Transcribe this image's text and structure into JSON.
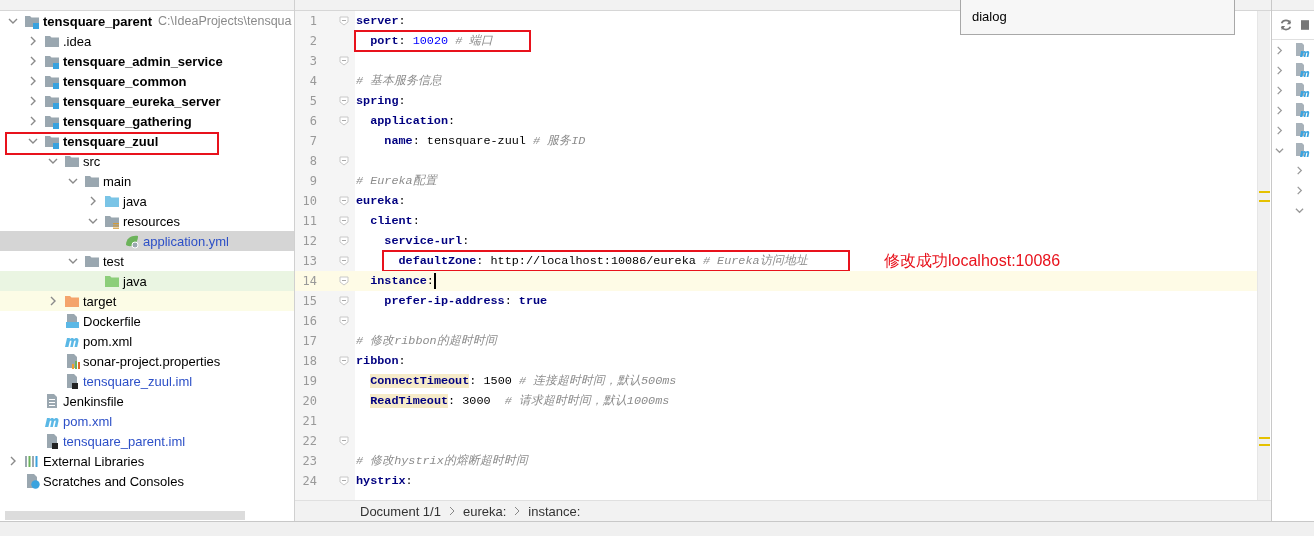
{
  "tooltip": {
    "text": "dialog"
  },
  "tree": [
    {
      "label": "tensquare_parent",
      "path": "C:\\IdeaProjects\\tensqua",
      "kind": "module",
      "bold": true,
      "modified": false,
      "expanded": true,
      "selected": false,
      "children": [
        {
          "label": ".idea",
          "kind": "folder",
          "bold": false,
          "modified": false,
          "expanded": false,
          "selected": false
        },
        {
          "label": "tensquare_admin_service",
          "kind": "module",
          "bold": true,
          "modified": false,
          "expanded": false,
          "selected": false
        },
        {
          "label": "tensquare_common",
          "kind": "module",
          "bold": true,
          "modified": false,
          "expanded": false,
          "selected": false
        },
        {
          "label": "tensquare_eureka_server",
          "kind": "module",
          "bold": true,
          "modified": false,
          "expanded": false,
          "selected": false
        },
        {
          "label": "tensquare_gathering",
          "kind": "module",
          "bold": true,
          "modified": false,
          "expanded": false,
          "selected": false
        },
        {
          "label": "tensquare_zuul",
          "kind": "module",
          "bold": true,
          "modified": false,
          "expanded": true,
          "boxed": true,
          "selected": false,
          "children": [
            {
              "label": "src",
              "kind": "folder",
              "bold": false,
              "modified": false,
              "expanded": true,
              "selected": false,
              "children": [
                {
                  "label": "main",
                  "kind": "folder",
                  "bold": false,
                  "modified": false,
                  "expanded": true,
                  "selected": false,
                  "children": [
                    {
                      "label": "java",
                      "kind": "source",
                      "bold": false,
                      "modified": false,
                      "expanded": false,
                      "selected": false
                    },
                    {
                      "label": "resources",
                      "kind": "resources",
                      "bold": false,
                      "modified": false,
                      "expanded": true,
                      "selected": false,
                      "children": [
                        {
                          "label": "application.yml",
                          "kind": "yml",
                          "bold": false,
                          "modified": true,
                          "selected": true
                        }
                      ]
                    }
                  ]
                },
                {
                  "label": "test",
                  "kind": "folder",
                  "bold": false,
                  "modified": false,
                  "expanded": true,
                  "selected": false,
                  "children": [
                    {
                      "label": "java",
                      "kind": "test",
                      "bold": false,
                      "modified": false,
                      "selected": false
                    }
                  ]
                }
              ]
            },
            {
              "label": "target",
              "kind": "excluded",
              "bold": false,
              "modified": false,
              "expanded": false,
              "selected": false
            },
            {
              "label": "Dockerfile",
              "kind": "docker",
              "bold": false,
              "modified": false,
              "selected": false
            },
            {
              "label": "pom.xml",
              "kind": "maven",
              "bold": false,
              "modified": false,
              "selected": false
            },
            {
              "label": "sonar-project.properties",
              "kind": "properties",
              "bold": false,
              "modified": false,
              "selected": false
            },
            {
              "label": "tensquare_zuul.iml",
              "kind": "iml",
              "bold": false,
              "modified": true,
              "selected": false
            }
          ]
        },
        {
          "label": "Jenkinsfile",
          "kind": "text",
          "bold": false,
          "modified": false,
          "selected": false
        },
        {
          "label": "pom.xml",
          "kind": "maven",
          "bold": false,
          "modified": true,
          "selected": false
        },
        {
          "label": "tensquare_parent.iml",
          "kind": "iml",
          "bold": false,
          "modified": true,
          "selected": false
        }
      ]
    },
    {
      "label": "External Libraries",
      "kind": "libraries",
      "bold": false,
      "modified": false,
      "expanded": false,
      "selected": false
    },
    {
      "label": "Scratches and Consoles",
      "kind": "scratches",
      "bold": false,
      "modified": false,
      "selected": false
    }
  ],
  "editor": {
    "lines": [
      {
        "number": "1",
        "fold": true,
        "code": [
          {
            "kind": "key",
            "text": "server"
          },
          {
            "kind": "punct",
            "text": ":"
          }
        ]
      },
      {
        "number": "2",
        "boxed": true,
        "code": [
          {
            "kind": "key",
            "text": "  port"
          },
          {
            "kind": "punct",
            "text": ": "
          },
          {
            "kind": "num",
            "text": "10020"
          },
          {
            "kind": "comment",
            "text": " # 端口"
          }
        ]
      },
      {
        "number": "3",
        "fold": true
      },
      {
        "number": "4",
        "code": [
          {
            "kind": "comment",
            "text": "# 基本服务信息"
          }
        ]
      },
      {
        "number": "5",
        "fold": true,
        "code": [
          {
            "kind": "key",
            "text": "spring"
          },
          {
            "kind": "punct",
            "text": ":"
          }
        ]
      },
      {
        "number": "6",
        "fold": true,
        "code": [
          {
            "kind": "key",
            "text": "  application"
          },
          {
            "kind": "punct",
            "text": ":"
          }
        ]
      },
      {
        "number": "7",
        "code": [
          {
            "kind": "key",
            "text": "    name"
          },
          {
            "kind": "punct",
            "text": ": "
          },
          {
            "kind": "str",
            "text": "tensquare-zuul"
          },
          {
            "kind": "comment",
            "text": " # 服务ID"
          }
        ]
      },
      {
        "number": "8",
        "fold": true
      },
      {
        "number": "9",
        "code": [
          {
            "kind": "comment",
            "text": "# Eureka配置"
          }
        ]
      },
      {
        "number": "10",
        "fold": true,
        "code": [
          {
            "kind": "key",
            "text": "eureka"
          },
          {
            "kind": "punct",
            "text": ":"
          }
        ]
      },
      {
        "number": "11",
        "fold": true,
        "code": [
          {
            "kind": "key",
            "text": "  client"
          },
          {
            "kind": "punct",
            "text": ":"
          }
        ]
      },
      {
        "number": "12",
        "fold": true,
        "code": [
          {
            "kind": "key",
            "text": "    service-url"
          },
          {
            "kind": "punct",
            "text": ":"
          }
        ]
      },
      {
        "number": "13",
        "fold": true,
        "boxed": true,
        "note": "修改成功localhost:10086",
        "code": [
          {
            "kind": "key",
            "text": "      defaultZone"
          },
          {
            "kind": "punct",
            "text": ": "
          },
          {
            "kind": "str",
            "text": "http://localhost:10086/eureka"
          },
          {
            "kind": "comment",
            "text": " # Eureka访问地址"
          }
        ]
      },
      {
        "number": "14",
        "fold": true,
        "current": true,
        "code": [
          {
            "kind": "key",
            "text": "  instance"
          },
          {
            "kind": "punct",
            "text": ":"
          }
        ]
      },
      {
        "number": "15",
        "fold": true,
        "code": [
          {
            "kind": "key",
            "text": "    prefer-ip-address"
          },
          {
            "kind": "punct",
            "text": ": "
          },
          {
            "kind": "bool",
            "text": "true"
          }
        ]
      },
      {
        "number": "16",
        "fold": true
      },
      {
        "number": "17",
        "code": [
          {
            "kind": "comment",
            "text": "# 修改ribbon的超时时间"
          }
        ]
      },
      {
        "number": "18",
        "fold": true,
        "code": [
          {
            "kind": "key",
            "text": "ribbon"
          },
          {
            "kind": "punct",
            "text": ":"
          }
        ]
      },
      {
        "number": "19",
        "code": [
          {
            "kind": "keyhl",
            "text": "  ConnectTimeout"
          },
          {
            "kind": "punct",
            "text": ": "
          },
          {
            "kind": "str",
            "text": "1500"
          },
          {
            "kind": "comment",
            "text": " # 连接超时时间，默认500ms"
          }
        ]
      },
      {
        "number": "20",
        "code": [
          {
            "kind": "keyhl",
            "text": "  ReadTimeout"
          },
          {
            "kind": "punct",
            "text": ": "
          },
          {
            "kind": "str",
            "text": "3000"
          },
          {
            "kind": "comment",
            "text": "  # 请求超时时间，默认1000ms"
          }
        ]
      },
      {
        "number": "21"
      },
      {
        "number": "22",
        "fold": true
      },
      {
        "number": "23",
        "code": [
          {
            "kind": "comment",
            "text": "# 修改hystrix的熔断超时时间"
          }
        ]
      },
      {
        "number": "24",
        "fold": true,
        "code": [
          {
            "kind": "key",
            "text": "hystrix"
          },
          {
            "kind": "punct",
            "text": ":"
          }
        ]
      }
    ],
    "breadcrumbs": [
      "Document 1/1",
      "eureka:",
      "instance:"
    ]
  }
}
